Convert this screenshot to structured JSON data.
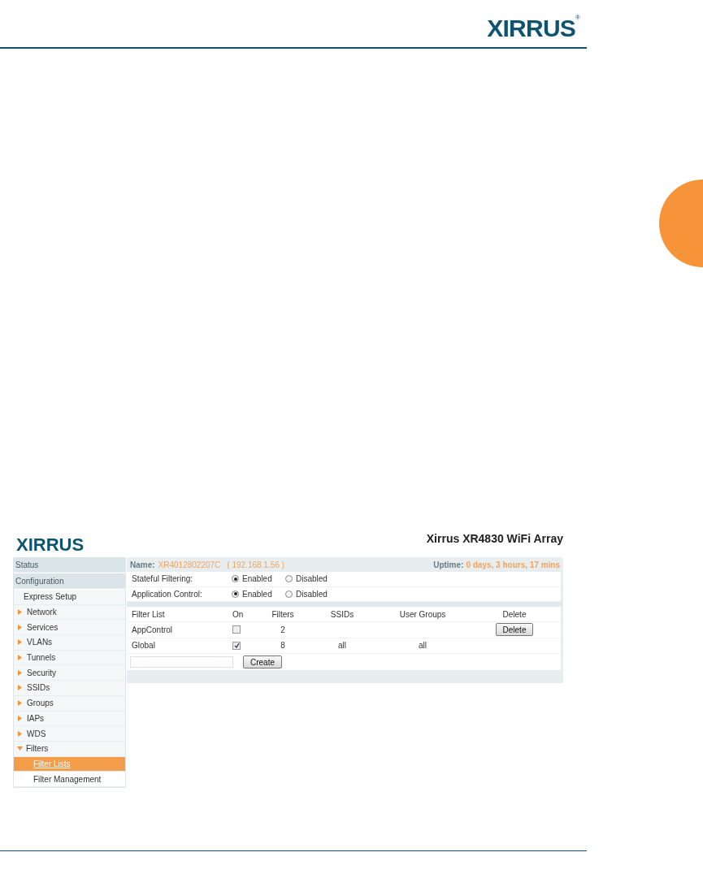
{
  "page_header": {
    "logo": "XIRRUS",
    "logo_mark": "®"
  },
  "screenshot": {
    "logo": "XIRRUS",
    "title": "Xirrus XR4830 WiFi Array",
    "name_label": "Name:",
    "name_value": "XR4012802207C",
    "ip": "( 192.168.1.56 )",
    "uptime_label": "Uptime:",
    "uptime_value": "0 days, 3 hours, 17 mins",
    "sidebar": [
      {
        "label": "Status",
        "kind": "header",
        "selected": false
      },
      {
        "label": "Configuration",
        "kind": "header",
        "selected": false
      },
      {
        "label": "Express Setup",
        "kind": "link",
        "selected": false
      },
      {
        "label": "Network",
        "kind": "group",
        "expanded": false,
        "selected": false
      },
      {
        "label": "Services",
        "kind": "group",
        "expanded": false,
        "selected": false
      },
      {
        "label": "VLANs",
        "kind": "group",
        "expanded": false,
        "selected": false
      },
      {
        "label": "Tunnels",
        "kind": "group",
        "expanded": false,
        "selected": false
      },
      {
        "label": "Security",
        "kind": "group",
        "expanded": false,
        "selected": false
      },
      {
        "label": "SSIDs",
        "kind": "group",
        "expanded": false,
        "selected": false
      },
      {
        "label": "Groups",
        "kind": "group",
        "expanded": false,
        "selected": false
      },
      {
        "label": "IAPs",
        "kind": "group",
        "expanded": false,
        "selected": false
      },
      {
        "label": "WDS",
        "kind": "group",
        "expanded": false,
        "selected": false
      },
      {
        "label": "Filters",
        "kind": "group",
        "expanded": true,
        "selected": false
      },
      {
        "label": "Filter Lists",
        "kind": "subitem",
        "selected": true
      },
      {
        "label": "Filter Management",
        "kind": "subitem",
        "selected": false
      }
    ],
    "settings": [
      {
        "label": "Stateful Filtering:",
        "options": [
          {
            "label": "Enabled",
            "selected": true
          },
          {
            "label": "Disabled",
            "selected": false
          }
        ]
      },
      {
        "label": "Application Control:",
        "options": [
          {
            "label": "Enabled",
            "selected": true
          },
          {
            "label": "Disabled",
            "selected": false
          }
        ]
      }
    ],
    "table": {
      "columns": [
        "Filter List",
        "On",
        "Filters",
        "SSIDs",
        "User Groups",
        "Delete"
      ],
      "rows": [
        {
          "filter_list": "AppControl",
          "on": false,
          "filters": "2",
          "delete_button": "Delete"
        },
        {
          "filter_list": "Global",
          "on": true,
          "filters": "8",
          "ssids": "all",
          "user_groups": "all"
        }
      ]
    },
    "create_button": "Create"
  }
}
